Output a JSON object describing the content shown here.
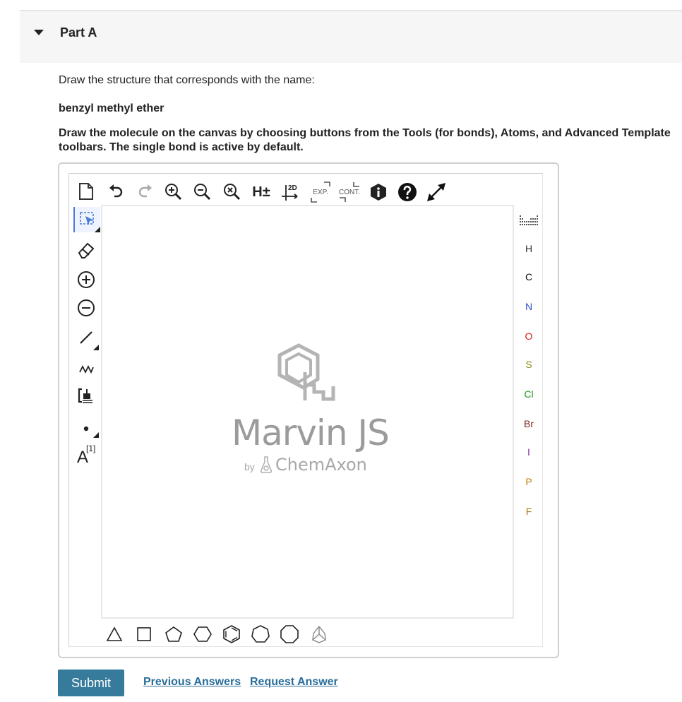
{
  "part": {
    "title": "Part A"
  },
  "question": {
    "prompt": "Draw the structure that corresponds with the name:",
    "compound_name": "benzyl methyl ether",
    "instructions": "Draw the molecule on the canvas by choosing buttons from the Tools (for bonds), Atoms, and Advanced Template toolbars. The single bond is active by default."
  },
  "editor": {
    "top_toolbar": {
      "hydrogen_label": "H±",
      "clean2d_label": "2D",
      "expand_label": "EXP.",
      "contract_label": "CONT."
    },
    "left_tools": {
      "atom_map_label": "[1]",
      "text_tool_label": "A"
    },
    "atoms": [
      {
        "symbol": "H",
        "color": "#333333"
      },
      {
        "symbol": "C",
        "color": "#111111"
      },
      {
        "symbol": "N",
        "color": "#3050c0"
      },
      {
        "symbol": "O",
        "color": "#d0201a"
      },
      {
        "symbol": "S",
        "color": "#8a8a10"
      },
      {
        "symbol": "Cl",
        "color": "#1f9a1f"
      },
      {
        "symbol": "Br",
        "color": "#7a2a2a"
      },
      {
        "symbol": "I",
        "color": "#8a2aa0"
      },
      {
        "symbol": "P",
        "color": "#c08000"
      },
      {
        "symbol": "F",
        "color": "#a87c10"
      }
    ],
    "watermark": {
      "title": "Marvin JS",
      "by": "by",
      "brand": "ChemAxon"
    }
  },
  "actions": {
    "submit_label": "Submit",
    "previous_answers_label": "Previous Answers",
    "request_answer_label": "Request Answer"
  },
  "colors": {
    "submit_bg": "#367b9b",
    "link": "#2a6e9a",
    "header_bg": "#f6f6f6"
  }
}
